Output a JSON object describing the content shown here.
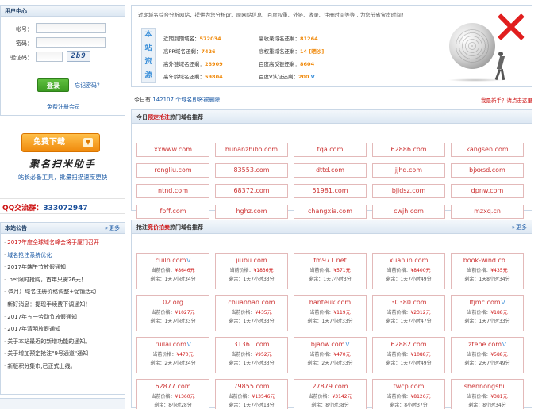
{
  "login": {
    "title": "用户中心",
    "account_label": "帐号：",
    "password_label": "密码：",
    "captcha_label": "验证码：",
    "captcha_code": "2b9",
    "login_button": "登录",
    "forgot": "忘记密码？",
    "register": "免费注册会员"
  },
  "download": {
    "button": "免费下载",
    "title": "聚名扫米助手",
    "subtitle": "站长必备工具，批量扫描速度更快"
  },
  "qq": {
    "label": "QQ交流群：",
    "number": "333072947"
  },
  "notice": {
    "title": "本站公告",
    "more": "更多",
    "items": [
      {
        "text": "2017年度全球域名峰会将于厦门召开",
        "style": "red"
      },
      {
        "text": "域名抢注系统优化",
        "style": "blue"
      },
      {
        "text": "2017年端午节放假通知",
        "style": ""
      },
      {
        "text": ".net限时抢购，首年只需26元！",
        "style": ""
      },
      {
        "text": "（5月）域名注册价格调整+促销活动",
        "style": ""
      },
      {
        "text": "新好消息：提现手续费下调通知！",
        "style": ""
      },
      {
        "text": "2017年五一劳动节放假通知",
        "style": ""
      },
      {
        "text": "2017年清明放假通知",
        "style": ""
      },
      {
        "text": "关于本站最近的新增功能的通知。",
        "style": ""
      },
      {
        "text": "关于增加预定抢注\"9号通道\"通知",
        "style": ""
      },
      {
        "text": "新版积分集市,已正式上线。",
        "style": ""
      }
    ]
  },
  "stats": {
    "intro": "过期域名综合分析网站，提供为您分析pr、原网站信息、百度权重、外链、收录、注册时间等等…为您节省宝贵时间！",
    "tag": [
      "本",
      "站",
      "资",
      "源"
    ],
    "rows": [
      {
        "l1": "近期到期域名：",
        "v1": "572034",
        "l2": "高收录域名还剩：",
        "v2": "81264"
      },
      {
        "l1": "高PR域名还剩：",
        "v1": "7426",
        "l2": "高权重域名还剩：",
        "v2": "14 [晒沙]"
      },
      {
        "l1": "高外链域名还剩：",
        "v1": "28909",
        "l2": "百度高反链还剩：",
        "v2": "8604"
      },
      {
        "l1": "高年龄域名还剩：",
        "v1": "59804",
        "l2": "百度V认证还剩：",
        "v2": "200"
      }
    ]
  },
  "searched": {
    "prefix": "今日有",
    "count": "142107",
    "suffix": "个域名即将被删除",
    "newbie": "我是新手？请点击这里"
  },
  "hot": {
    "title_prefix": "今日",
    "title_highlight": "预定抢注",
    "title_suffix": "热门域名推荐",
    "domains": [
      "xxwww.com",
      "hunanzhibo.com",
      "tqa.com",
      "62886.com",
      "kangsen.com",
      "rongliu.com",
      "83553.com",
      "dttd.com",
      "jjhq.com",
      "bjxxsd.com",
      "ntnd.com",
      "68372.com",
      "51981.com",
      "bjjdsz.com",
      "dpnw.com",
      "fpff.com",
      "hghz.com",
      "changxia.com",
      "cwjh.com",
      "mzxq.cn"
    ]
  },
  "auction": {
    "title_prefix": "抢注",
    "title_highlight": "竞价拍卖",
    "title_suffix": "热门域名推荐",
    "more": "更多",
    "price_label": "当前价格：",
    "remain_label": "剩余：",
    "items": [
      {
        "domain": "cuiln.com",
        "v": true,
        "price": "¥8646元",
        "remain": "1天7小时34分"
      },
      {
        "domain": "jiubu.com",
        "v": false,
        "price": "¥1836元",
        "remain": "1天7小时33分"
      },
      {
        "domain": "fm971.net",
        "v": false,
        "price": "¥571元",
        "remain": "1天7小时3分"
      },
      {
        "domain": "xuanlin.com",
        "v": false,
        "price": "¥8400元",
        "remain": "1天7小时49分"
      },
      {
        "domain": "book-wind.co...",
        "v": false,
        "price": "¥435元",
        "remain": "1天8小时34分"
      },
      {
        "domain": "02.org",
        "v": false,
        "price": "¥1027元",
        "remain": "1天7小时33分"
      },
      {
        "domain": "chuanhan.com",
        "v": false,
        "price": "¥435元",
        "remain": "1天7小时33分"
      },
      {
        "domain": "hanteuk.com",
        "v": false,
        "price": "¥119元",
        "remain": "1天7小时33分"
      },
      {
        "domain": "30380.com",
        "v": false,
        "price": "¥2312元",
        "remain": "1天7小时47分"
      },
      {
        "domain": "lfjmc.com",
        "v": true,
        "price": "¥188元",
        "remain": "1天7小时33分"
      },
      {
        "domain": "ruilai.com",
        "v": true,
        "price": "¥470元",
        "remain": "2天7小时34分"
      },
      {
        "domain": "31361.com",
        "v": false,
        "price": "¥952元",
        "remain": "1天7小时33分"
      },
      {
        "domain": "bjanw.com",
        "v": true,
        "price": "¥470元",
        "remain": "2天7小时33分"
      },
      {
        "domain": "62882.com",
        "v": false,
        "price": "¥1088元",
        "remain": "1天7小时49分"
      },
      {
        "domain": "ztepe.com",
        "v": true,
        "price": "¥588元",
        "remain": "2天7小时49分"
      },
      {
        "domain": "62877.com",
        "v": false,
        "price": "¥1360元",
        "remain": "8小时28分"
      },
      {
        "domain": "79855.com",
        "v": false,
        "price": "¥13546元",
        "remain": "1天7小时18分"
      },
      {
        "domain": "27879.com",
        "v": false,
        "price": "¥3142元",
        "remain": "8小时38分"
      },
      {
        "domain": "twcp.com",
        "v": false,
        "price": "¥8126元",
        "remain": "8小时37分"
      },
      {
        "domain": "shennongshi...",
        "v": false,
        "price": "¥381元",
        "remain": "8小时34分"
      }
    ]
  },
  "colors": {
    "accent": "#cc1111",
    "link": "#1a59a5",
    "orange": "#f08a0c",
    "border": "#c9d7e6"
  },
  "icons": [
    "close-x-icon",
    "download-arrow-icon",
    "sphere-sculpture-image",
    "v-certified-icon"
  ]
}
